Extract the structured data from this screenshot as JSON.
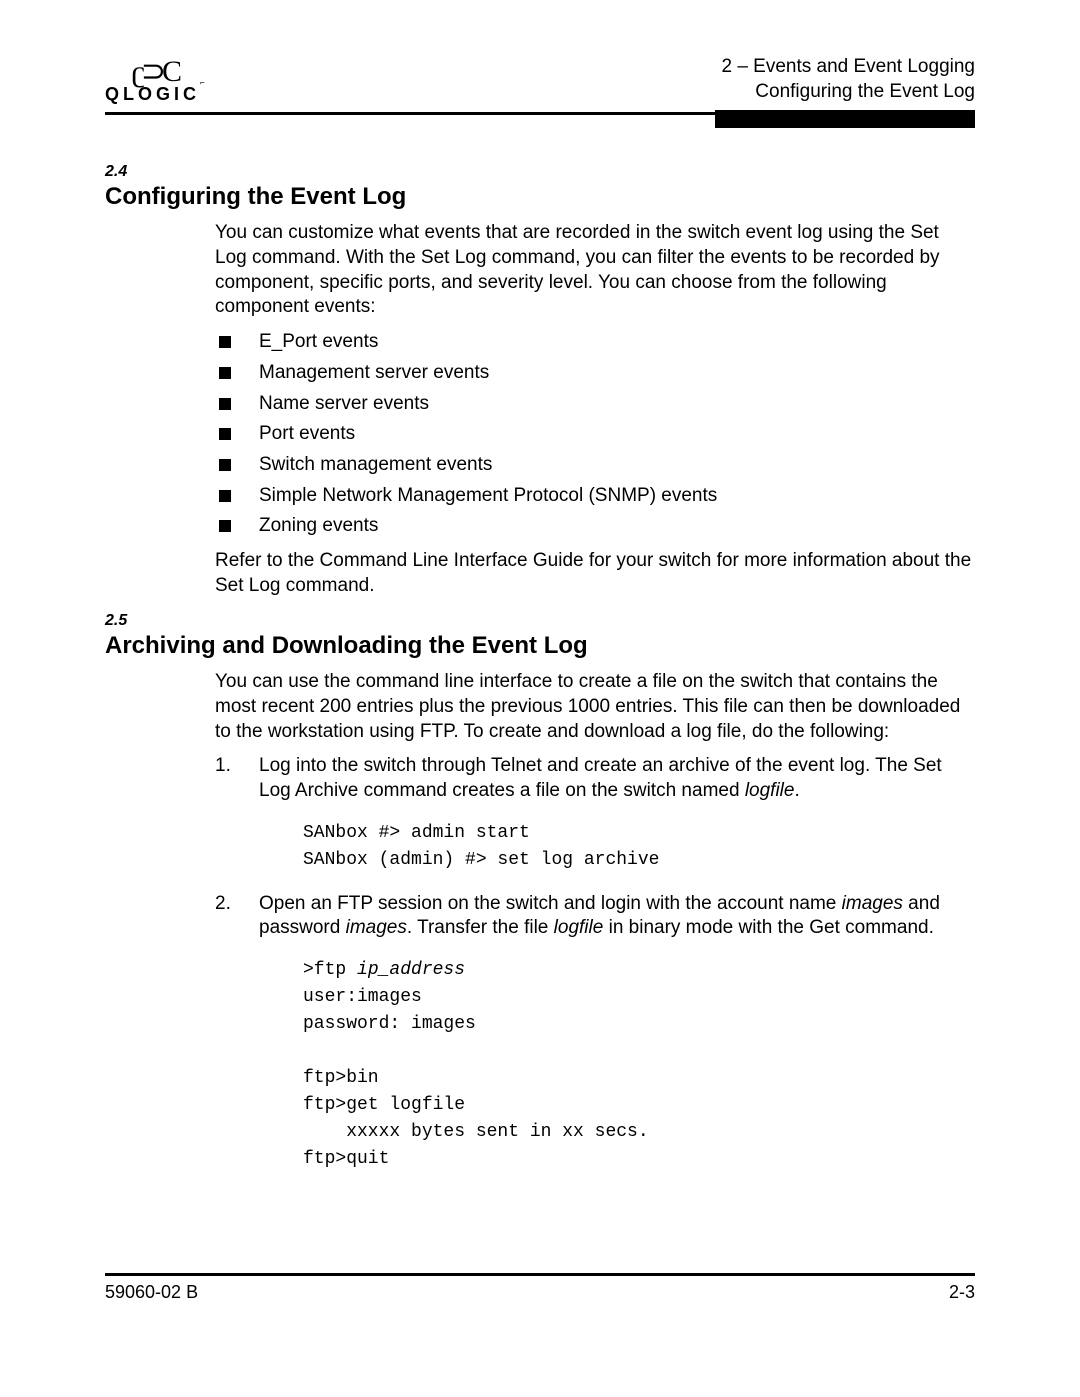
{
  "logo": {
    "symbol": "ʗ⊃C",
    "text": "QLOGIC",
    "corner": "⌐"
  },
  "header": {
    "line1": "2 – Events and Event Logging",
    "line2": "Configuring the Event Log"
  },
  "section_24": {
    "number": "2.4",
    "title": "Configuring the Event Log",
    "intro": "You can customize what events that are recorded in the switch event log using the Set Log command. With the Set Log command, you can filter the events to be recorded by component, specific ports, and severity level. You can choose from the following component events:",
    "bullets": [
      "E_Port events",
      "Management server events",
      "Name server events",
      "Port events",
      "Switch management events",
      "Simple Network Management Protocol (SNMP) events",
      "Zoning events"
    ],
    "outro": "Refer to the Command Line Interface Guide for your switch for more information about the Set Log command."
  },
  "section_25": {
    "number": "2.5",
    "title": "Archiving and Downloading the Event Log",
    "intro": "You can use the command line interface to create a file on the switch that contains the most recent 200 entries plus the previous 1000 entries. This file can then be downloaded to the workstation using FTP. To create and download a log file, do the following:",
    "step1": {
      "text_before": "Log into the switch through Telnet and create an archive of the event log. The Set Log Archive command creates a file on the switch named ",
      "italic": "logfile",
      "text_after": ".",
      "code": "SANbox #> admin start\nSANbox (admin) #> set log archive"
    },
    "step2": {
      "t1": "Open an FTP session on the switch and login with the account name ",
      "i1": "images",
      "t2": " and password ",
      "i2": "images",
      "t3": ". Transfer the file ",
      "i3": "logfile",
      "t4": " in binary mode with the Get command.",
      "code_pre": ">ftp ",
      "code_italic": "ip_address",
      "code_rest": "\nuser:images\npassword: images\n\nftp>bin\nftp>get logfile\n    xxxxx bytes sent in xx secs.\nftp>quit"
    }
  },
  "footer": {
    "left": "59060-02 B",
    "right": "2-3"
  }
}
